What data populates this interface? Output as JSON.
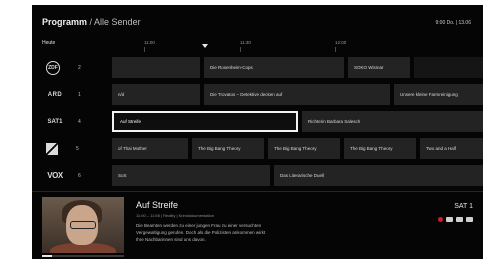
{
  "header": {
    "title": "Programm",
    "subtitle": "/ Alle Sender",
    "datetime": "9:00 Do. | 13.06"
  },
  "timeline": {
    "today": "Heute",
    "ticks": [
      "11:00",
      "11:30",
      "12:00"
    ]
  },
  "channels": [
    {
      "logo": "ZDF",
      "number": "2",
      "programs": [
        {
          "title": ""
        },
        {
          "title": "Die Rosenheim-Cops"
        },
        {
          "title": "SOKO Wismar"
        }
      ]
    },
    {
      "logo": "ARD",
      "number": "1",
      "programs": [
        {
          "title": "n/d"
        },
        {
          "title": "Die Trovatos – Detektive decken auf"
        },
        {
          "title": "Unsere kleine Farmreinigung"
        }
      ]
    },
    {
      "logo": "SAT1",
      "number": "4",
      "programs": [
        {
          "title": "Auf Streife"
        },
        {
          "title": "Richterin Barbara Salesch"
        }
      ]
    },
    {
      "logo": "Pro7",
      "number": "5",
      "programs": [
        {
          "title": "of Thai Mother"
        },
        {
          "title": "The Big Bang Theory"
        },
        {
          "title": "The Big Bang Theory"
        },
        {
          "title": "The Big Bang Theory"
        },
        {
          "title": "Two and a Half"
        }
      ]
    },
    {
      "logo": "VOX",
      "number": "6",
      "programs": [
        {
          "title": "SoS"
        },
        {
          "title": "Das Literarische Duell"
        }
      ]
    }
  ],
  "details": {
    "title": "Auf Streife",
    "meta": "11:00 – 11:55 | Reality | Krimidokumentation",
    "description": [
      "Die Beamten werden zu einer jungen Frau zu einer versuchten",
      "Vergewaltigung gerufen. Doch als die Polizisten ankommen wirkt",
      "Ihre Nachbarinnen sind uns davon."
    ],
    "channel": "SAT 1",
    "icons": [
      "record-icon",
      "subtitles-icon",
      "hd-icon",
      "audio-icon"
    ],
    "progress": 0.12
  }
}
